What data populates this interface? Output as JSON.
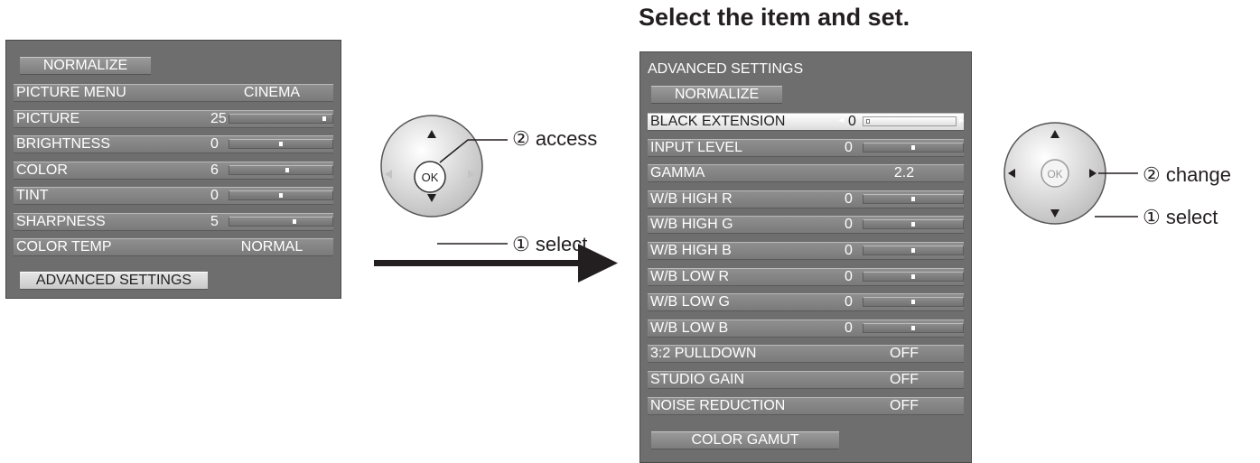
{
  "title": "Select the item and set.",
  "left_panel": {
    "top_button": "NORMALIZE",
    "rows": [
      {
        "label": "PICTURE MENU",
        "type": "text",
        "value": "CINEMA"
      },
      {
        "label": "PICTURE",
        "type": "slider",
        "value": "25",
        "level": 0.92
      },
      {
        "label": "BRIGHTNESS",
        "type": "slider",
        "value": "0",
        "level": 0.5
      },
      {
        "label": "COLOR",
        "type": "slider",
        "value": "6",
        "level": 0.56
      },
      {
        "label": "TINT",
        "type": "slider",
        "value": "0",
        "level": 0.5
      },
      {
        "label": "SHARPNESS",
        "type": "slider",
        "value": "5",
        "level": 0.63
      },
      {
        "label": "COLOR TEMP",
        "type": "text",
        "value": "NORMAL"
      }
    ],
    "bottom_button": "ADVANCED SETTINGS"
  },
  "right_panel": {
    "heading": "ADVANCED SETTINGS",
    "top_button": "NORMALIZE",
    "rows": [
      {
        "label": "BLACK EXTENSION",
        "type": "slider",
        "value": "0",
        "level": 0.0,
        "selected": true
      },
      {
        "label": "INPUT LEVEL",
        "type": "slider",
        "value": "0",
        "level": 0.5
      },
      {
        "label": "GAMMA",
        "type": "text",
        "value": "2.2"
      },
      {
        "label": "W/B HIGH R",
        "type": "slider",
        "value": "0",
        "level": 0.5
      },
      {
        "label": "W/B HIGH G",
        "type": "slider",
        "value": "0",
        "level": 0.5
      },
      {
        "label": "W/B HIGH B",
        "type": "slider",
        "value": "0",
        "level": 0.5
      },
      {
        "label": "W/B LOW R",
        "type": "slider",
        "value": "0",
        "level": 0.5
      },
      {
        "label": "W/B LOW G",
        "type": "slider",
        "value": "0",
        "level": 0.5
      },
      {
        "label": "W/B LOW B",
        "type": "slider",
        "value": "0",
        "level": 0.5
      },
      {
        "label": "3:2 PULLDOWN",
        "type": "text",
        "value": "OFF"
      },
      {
        "label": "STUDIO GAIN",
        "type": "text",
        "value": "OFF"
      },
      {
        "label": "NOISE REDUCTION",
        "type": "text",
        "value": "OFF"
      }
    ],
    "bottom_button": "COLOR GAMUT"
  },
  "remote_1": {
    "ok_label": "OK",
    "callout_access": "② access",
    "callout_select": "① select"
  },
  "remote_2": {
    "ok_label": "OK",
    "callout_change": "② change",
    "callout_select": "① select"
  },
  "colors": {
    "panel": "#6e6e6e",
    "row": "#808080",
    "selected_row": "#ffffff",
    "text": "#ffffff",
    "title": "#231f20"
  }
}
